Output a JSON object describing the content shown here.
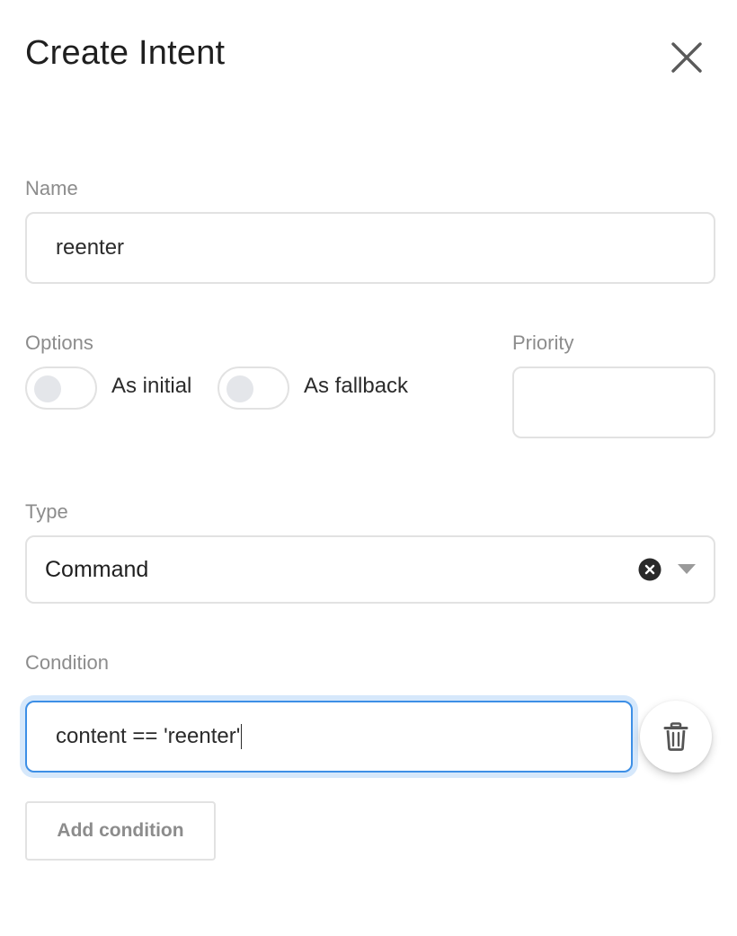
{
  "modal": {
    "title": "Create Intent",
    "close_icon": "close-icon"
  },
  "name_field": {
    "label": "Name",
    "value": "reenter"
  },
  "options": {
    "label": "Options",
    "toggles": [
      {
        "label": "As initial",
        "checked": false
      },
      {
        "label": "As fallback",
        "checked": false
      }
    ]
  },
  "priority_field": {
    "label": "Priority",
    "value": ""
  },
  "type_field": {
    "label": "Type",
    "selected": "Command",
    "clear_icon": "clear-circle-icon",
    "dropdown_icon": "chevron-down-icon"
  },
  "condition": {
    "label": "Condition",
    "value": "content == 'reenter'",
    "delete_icon": "trash-icon",
    "add_label": "Add condition"
  },
  "colors": {
    "focus_border": "#3d8fe6",
    "focus_glow": "#d6e8fb",
    "muted_text": "#8c8c8c",
    "border": "#e2e2e2"
  }
}
